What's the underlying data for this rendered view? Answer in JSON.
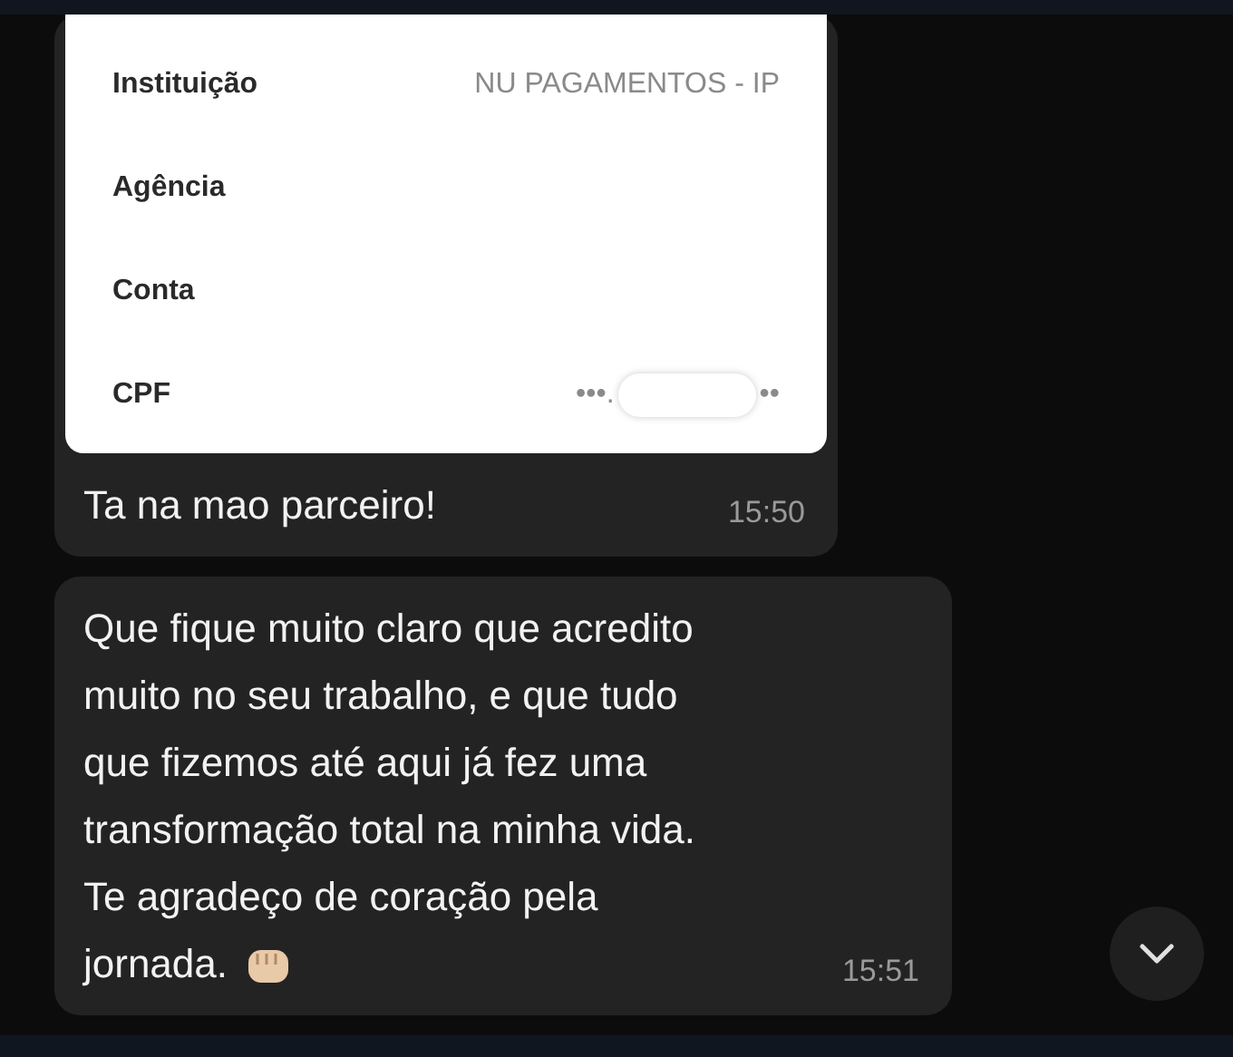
{
  "messages": [
    {
      "kind": "card",
      "card_rows": [
        {
          "label": "Instituição",
          "value": "NU PAGAMENTOS - IP"
        },
        {
          "label": "Agência"
        },
        {
          "label": "Conta"
        },
        {
          "label": "CPF",
          "masked": true,
          "value_start": "•••.",
          "value_end": "••"
        }
      ],
      "text": "Ta na mao parceiro!",
      "time": "15:50"
    },
    {
      "kind": "text",
      "text": "Que fique muito claro que acredito\nmuito no seu trabalho, e que tudo\nque fizemos até aqui já fez uma\ntransformação total na minha vida.\nTe agradeço de coração pela\njornada.",
      "emoji": true,
      "time": "15:51"
    }
  ]
}
